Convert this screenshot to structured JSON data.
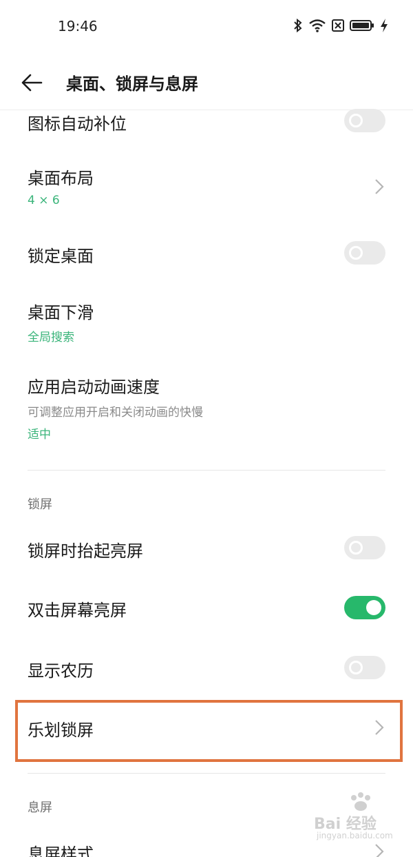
{
  "status_bar": {
    "time": "19:46"
  },
  "header": {
    "title": "桌面、锁屏与息屏"
  },
  "desktop_items": {
    "icon_auto_fill": {
      "title": "图标自动补位",
      "enabled": false
    },
    "layout": {
      "title": "桌面布局",
      "value": "4 × 6"
    },
    "lock_desktop": {
      "title": "锁定桌面",
      "enabled": false
    },
    "swipe_down": {
      "title": "桌面下滑",
      "value": "全局搜索"
    },
    "anim_speed": {
      "title": "应用启动动画速度",
      "description": "可调整应用开启和关闭动画的快慢",
      "value": "适中"
    }
  },
  "lock_section": {
    "label": "锁屏",
    "lift_to_wake": {
      "title": "锁屏时抬起亮屏",
      "enabled": false
    },
    "double_tap": {
      "title": "双击屏幕亮屏",
      "enabled": true
    },
    "lunar_calendar": {
      "title": "显示农历",
      "enabled": false
    },
    "lehua_lock": {
      "title": "乐划锁屏"
    }
  },
  "aod_section": {
    "label": "息屏",
    "aod_style": {
      "title": "息屏样式"
    }
  },
  "watermark": {
    "text": "Bai 经验",
    "sub": "jingyan.baidu.com"
  },
  "colors": {
    "accent_green": "#27b86b",
    "value_green": "#3ab47a",
    "highlight": "#e0743f"
  }
}
